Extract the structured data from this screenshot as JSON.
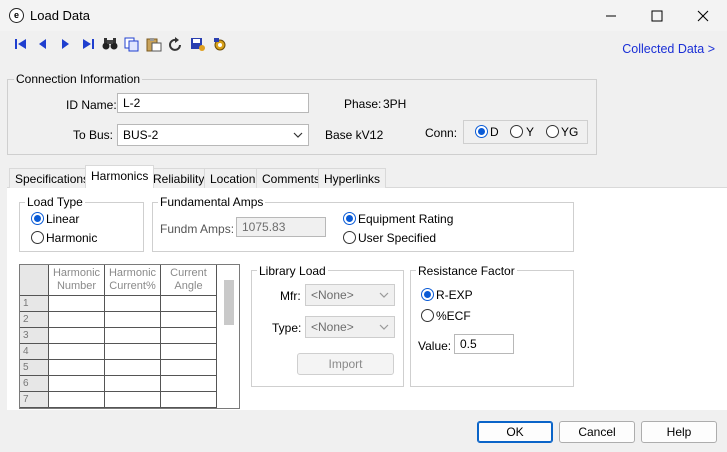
{
  "window": {
    "title": "Load Data",
    "app_icon_glyph": "e"
  },
  "toolbar": {
    "icons": [
      "first-record-icon",
      "previous-record-icon",
      "next-record-icon",
      "last-record-icon",
      "find-icon",
      "copy-icon",
      "paste-icon",
      "undo-icon",
      "save-library-icon",
      "settings-icon"
    ],
    "collected_data_link": "Collected Data >"
  },
  "connection": {
    "legend": "Connection Information",
    "id_label": "ID Name:",
    "id_value": "L-2",
    "bus_label": "To Bus:",
    "bus_value": "BUS-2",
    "phase_label": "Phase:",
    "phase_value": "3PH",
    "basekv_label": "Base kV:",
    "basekv_value": "12",
    "conn_label": "Conn:",
    "conn_options": [
      "D",
      "Y",
      "YG"
    ],
    "conn_selected": "D"
  },
  "tabs": [
    "Specifications",
    "Harmonics",
    "Reliability",
    "Location",
    "Comments",
    "Hyperlinks"
  ],
  "active_tab": "Harmonics",
  "load_type": {
    "legend": "Load Type",
    "options": [
      "Linear",
      "Harmonic"
    ],
    "selected": "Linear"
  },
  "fundamental": {
    "legend": "Fundamental Amps",
    "amps_label": "Fundm Amps:",
    "amps_value": "1075.83",
    "options": [
      "Equipment Rating",
      "User Specified"
    ],
    "selected": "Equipment Rating"
  },
  "harmonic_table": {
    "headers": [
      "Harmonic Number",
      "Harmonic Current%",
      "Current Angle"
    ],
    "header_lines": [
      [
        "Harmonic",
        "Number"
      ],
      [
        "Harmonic",
        "Current%"
      ],
      [
        "Current",
        "Angle"
      ]
    ],
    "rows": [
      "1",
      "2",
      "3",
      "4",
      "5",
      "6",
      "7"
    ]
  },
  "library_load": {
    "legend": "Library Load",
    "mfr_label": "Mfr:",
    "mfr_value": "<None>",
    "type_label": "Type:",
    "type_value": "<None>",
    "import_label": "Import"
  },
  "resistance": {
    "legend": "Resistance Factor",
    "options": [
      "R-EXP",
      "%ECF"
    ],
    "selected": "R-EXP",
    "value_label": "Value:",
    "value": "0.5"
  },
  "buttons": {
    "ok": "OK",
    "cancel": "Cancel",
    "help": "Help"
  },
  "colors": {
    "accent": "#0a5bd6",
    "link": "#1a2fd6",
    "toolbar_blue": "#1f3fcf"
  }
}
